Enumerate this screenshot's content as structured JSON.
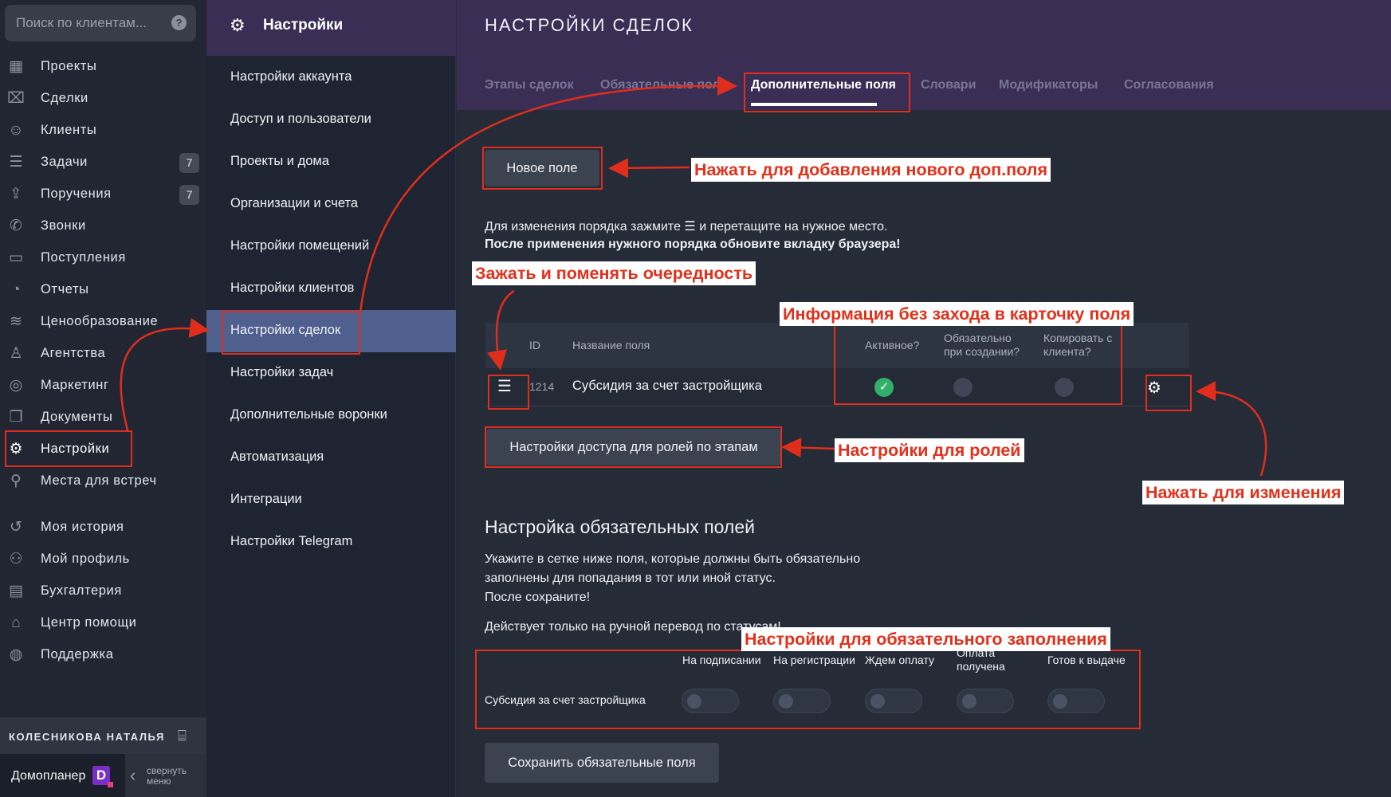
{
  "search": {
    "placeholder": "Поиск по клиентам...",
    "help": "?"
  },
  "nav": [
    {
      "label": "Проекты",
      "icon": "building-icon",
      "glyph": "▦"
    },
    {
      "label": "Сделки",
      "icon": "handshake-icon",
      "glyph": "⌧"
    },
    {
      "label": "Клиенты",
      "icon": "users-icon",
      "glyph": "☺"
    },
    {
      "label": "Задачи",
      "icon": "checklist-icon",
      "glyph": "☰",
      "badge": "7"
    },
    {
      "label": "Поручения",
      "icon": "assign-icon",
      "glyph": "⇪",
      "badge": "7"
    },
    {
      "label": "Звонки",
      "icon": "phone-icon",
      "glyph": "✆"
    },
    {
      "label": "Поступления",
      "icon": "wallet-icon",
      "glyph": "▭"
    },
    {
      "label": "Отчеты",
      "icon": "pie-chart-icon",
      "glyph": "◔"
    },
    {
      "label": "Ценообразование",
      "icon": "coins-icon",
      "glyph": "≋"
    },
    {
      "label": "Агентства",
      "icon": "agent-icon",
      "glyph": "♙"
    },
    {
      "label": "Маркетинг",
      "icon": "target-icon",
      "glyph": "◎"
    },
    {
      "label": "Документы",
      "icon": "documents-icon",
      "glyph": "❐"
    },
    {
      "label": "Настройки",
      "icon": "gear-icon",
      "glyph": "⚙"
    },
    {
      "label": "Места для встреч",
      "icon": "meeting-place-icon",
      "glyph": "⚲"
    },
    {
      "label": "Моя история",
      "icon": "history-icon",
      "glyph": "↺"
    },
    {
      "label": "Мой профиль",
      "icon": "profile-icon",
      "glyph": "⚇"
    },
    {
      "label": "Бухгалтерия",
      "icon": "accounting-icon",
      "glyph": "▤"
    },
    {
      "label": "Центр помощи",
      "icon": "help-center-icon",
      "glyph": "⌂"
    },
    {
      "label": "Поддержка",
      "icon": "support-icon",
      "glyph": "◍"
    }
  ],
  "user": {
    "name": "КОЛЕСНИКОВА НАТАЛЬЯ"
  },
  "brand": {
    "name": "Домопланер",
    "logo_letter": "D",
    "collapse_label": "свернуть меню"
  },
  "settings": {
    "title": "Настройки",
    "items": [
      "Настройки аккаунта",
      "Доступ и пользователи",
      "Проекты и дома",
      "Организации и счета",
      "Настройки помещений",
      "Настройки клиентов",
      "Настройки сделок",
      "Настройки задач",
      "Дополнительные воронки",
      "Автоматизация",
      "Интеграции",
      "Настройки Telegram"
    ]
  },
  "main": {
    "title": "НАСТРОЙКИ СДЕЛОК",
    "tabs": [
      "Этапы сделок",
      "Обязательные поля",
      "Дополнительные поля",
      "Словари",
      "Модификаторы",
      "Согласования"
    ],
    "new_field_btn": "Новое поле",
    "order_hint_1": "Для изменения порядка зажмите ☰ и перетащите на нужное место.",
    "order_hint_2": "После применения нужного порядка обновите вкладку браузера!",
    "table": {
      "headers": {
        "id": "ID",
        "name": "Название поля",
        "active": "Активное?",
        "required": "Обязательно при создании?",
        "copy": "Копировать с клиента?"
      },
      "rows": [
        {
          "id": "1214",
          "name": "Субсидия за счет застройщика",
          "active": true,
          "required": false,
          "copy": false
        }
      ]
    },
    "roles_btn": "Настройки доступа для ролей по этапам",
    "required_section": {
      "title": "Настройка обязательных полей",
      "desc": [
        "Укажите в сетке ниже поля, которые должны быть обязательно",
        "заполнены для попадания в тот или иной статус.",
        "После сохраните!"
      ],
      "note": "Действует только на ручной перевод по статусам!",
      "columns": [
        "На подписании",
        "На регистрации",
        "Ждем оплату",
        "Оплата получена",
        "Готов к выдаче"
      ],
      "row_label": "Субсидия за счет застройщика",
      "save_btn": "Сохранить обязательные поля"
    }
  },
  "annotations": {
    "new_field": "Нажать для добавления нового доп.поля",
    "drag": "Зажать и поменять очередность",
    "info": "Информация без захода в карточку поля",
    "roles": "Настройки для ролей",
    "edit": "Нажать для изменения",
    "required": "Настройки для обязательного заполнения"
  },
  "colors": {
    "accent_red": "#e12d1c",
    "header_purple": "#3a2e55",
    "active_item": "#4f5f8e",
    "check_green": "#30b06a"
  }
}
